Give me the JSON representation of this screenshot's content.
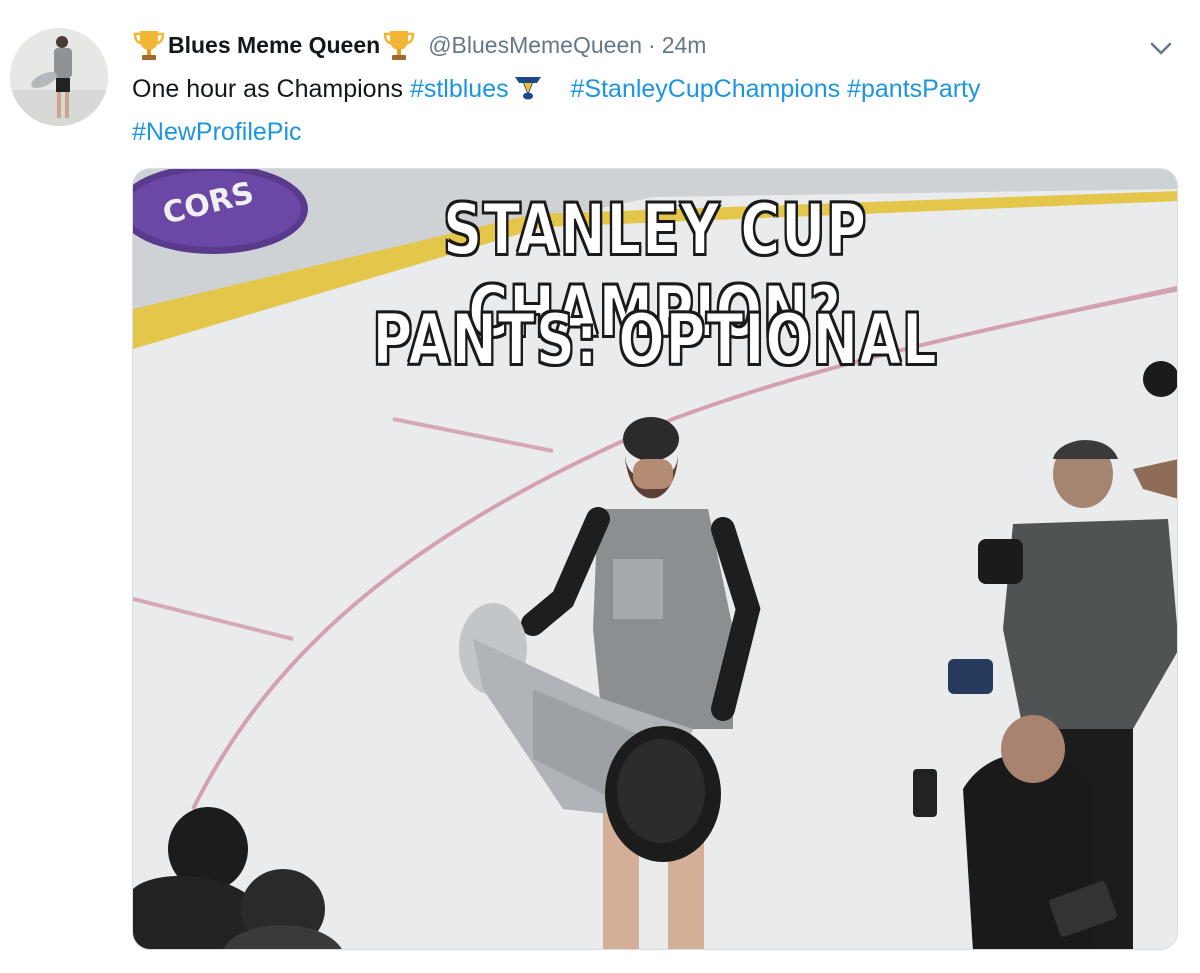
{
  "tweet": {
    "display_name": "Blues Meme Queen",
    "handle": "@BluesMemeQueen",
    "separator": "·",
    "time": "24m",
    "text_plain": "One hour as Champions",
    "hashtags": [
      "#stlblues",
      "#StanleyCupChampions",
      "#pantsParty",
      "#NewProfilePic"
    ],
    "icons": {
      "name_prefix": "trophy-icon",
      "name_suffix": "trophy-icon",
      "after_hashtag": "blues-note-icon",
      "menu": "chevron-down-icon"
    }
  },
  "media": {
    "meme_line1": "STANLEY CUP CHAMPION?",
    "meme_line2": "PANTS: OPTIONAL",
    "boards_text": "CORS"
  },
  "colors": {
    "hashtag": "#1b95e0",
    "name": "#14171a",
    "meta": "#657786",
    "trophy": "#f2b535"
  }
}
